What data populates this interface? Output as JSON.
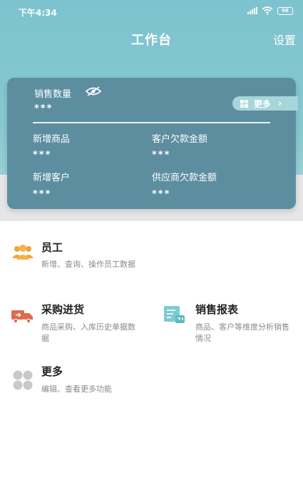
{
  "status_bar": {
    "time": "下午4:34",
    "battery": "96"
  },
  "nav": {
    "title": "工作台",
    "settings_label": "设置"
  },
  "summary_card": {
    "sales_qty_label": "销售数量",
    "sales_qty_value": "***",
    "more_label": "更多",
    "new_products_label": "新增商品",
    "new_products_value": "***",
    "customer_debt_label": "客户欠款金额",
    "customer_debt_value": "***",
    "new_customers_label": "新增客户",
    "new_customers_value": "***",
    "supplier_debt_label": "供应商欠款金额",
    "supplier_debt_value": "***"
  },
  "menu": {
    "staff": {
      "title": "员工",
      "desc": "新增、查询、操作员工数据"
    },
    "purchase": {
      "title": "采购进货",
      "desc_line1": "商品采购、入库历史单据数",
      "desc_line2": "据"
    },
    "sales_report": {
      "title": "销售报表",
      "desc_line1": "商品、客户等维度分析销售",
      "desc_line2": "情况"
    },
    "more": {
      "title": "更多",
      "desc": "编辑、查看更多功能"
    }
  },
  "colors": {
    "header_gradient": "#7cc3cf",
    "card": "#5c8ea0",
    "staff_icon": "#f0a33b",
    "purchase_icon": "#e06a4e",
    "report_icon": "#7ecbd0",
    "more_icon": "#c9c9c9"
  }
}
